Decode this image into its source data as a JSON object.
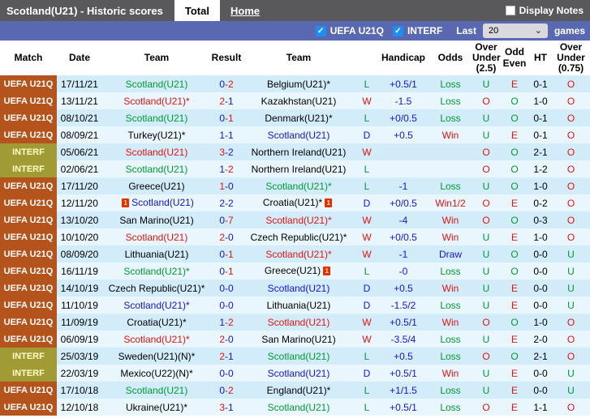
{
  "titlebar": {
    "title": "Scotland(U21) - Historic scores",
    "tabs": [
      {
        "label": "Total",
        "active": true
      },
      {
        "label": "Home",
        "active": false
      }
    ],
    "display_notes": {
      "label": "Display Notes",
      "checked": false
    }
  },
  "filterbar": {
    "filters": [
      {
        "label": "UEFA U21Q",
        "checked": true
      },
      {
        "label": "INTERF",
        "checked": true
      }
    ],
    "last_label": "Last",
    "selected_count": "20",
    "games_label": "games"
  },
  "table": {
    "headers": [
      "Match",
      "Date",
      "Team",
      "Result",
      "Team",
      "",
      "Handicap",
      "Odds",
      "Over\nUnder\n(2.5)",
      "Odd\nEven",
      "HT",
      "Over\nUnder\n(0.75)"
    ],
    "red_card_text": "1",
    "palette": {
      "red": "#e11414",
      "green": "#009933",
      "blue": "#1616cc",
      "black": "#000000"
    },
    "rows": [
      {
        "match": "UEFA U21Q",
        "match_type": "uefa",
        "date": "17/11/21",
        "home": {
          "name": "Scotland(U21)",
          "color": "green",
          "red_card": false
        },
        "score": {
          "home": "0",
          "away": "2",
          "home_color": "blue",
          "away_color": "red"
        },
        "away": {
          "name": "Belgium(U21)*",
          "color": "black",
          "red_card": false
        },
        "wdl": {
          "text": "L",
          "color": "green"
        },
        "handicap": "+0.5/1",
        "odds": {
          "text": "Loss",
          "color": "green"
        },
        "ou25": {
          "text": "U",
          "color": "green"
        },
        "odd_even": {
          "text": "E",
          "color": "red"
        },
        "ht": "0-1",
        "ou075": {
          "text": "O",
          "color": "red"
        }
      },
      {
        "match": "UEFA U21Q",
        "match_type": "uefa",
        "date": "13/11/21",
        "home": {
          "name": "Scotland(U21)*",
          "color": "red",
          "red_card": false
        },
        "score": {
          "home": "2",
          "away": "1",
          "home_color": "red",
          "away_color": "blue"
        },
        "away": {
          "name": "Kazakhstan(U21)",
          "color": "black",
          "red_card": false
        },
        "wdl": {
          "text": "W",
          "color": "red"
        },
        "handicap": "-1.5",
        "odds": {
          "text": "Loss",
          "color": "green"
        },
        "ou25": {
          "text": "O",
          "color": "red"
        },
        "odd_even": {
          "text": "O",
          "color": "green"
        },
        "ht": "1-0",
        "ou075": {
          "text": "O",
          "color": "red"
        }
      },
      {
        "match": "UEFA U21Q",
        "match_type": "uefa",
        "date": "08/10/21",
        "home": {
          "name": "Scotland(U21)",
          "color": "green",
          "red_card": false
        },
        "score": {
          "home": "0",
          "away": "1",
          "home_color": "blue",
          "away_color": "red"
        },
        "away": {
          "name": "Denmark(U21)*",
          "color": "black",
          "red_card": false
        },
        "wdl": {
          "text": "L",
          "color": "green"
        },
        "handicap": "+0/0.5",
        "odds": {
          "text": "Loss",
          "color": "green"
        },
        "ou25": {
          "text": "U",
          "color": "green"
        },
        "odd_even": {
          "text": "O",
          "color": "green"
        },
        "ht": "0-1",
        "ou075": {
          "text": "O",
          "color": "red"
        }
      },
      {
        "match": "UEFA U21Q",
        "match_type": "uefa",
        "date": "08/09/21",
        "home": {
          "name": "Turkey(U21)*",
          "color": "black",
          "red_card": false
        },
        "score": {
          "home": "1",
          "away": "1",
          "home_color": "blue",
          "away_color": "blue"
        },
        "away": {
          "name": "Scotland(U21)",
          "color": "blue",
          "red_card": false
        },
        "wdl": {
          "text": "D",
          "color": "blue"
        },
        "handicap": "+0.5",
        "odds": {
          "text": "Win",
          "color": "red"
        },
        "ou25": {
          "text": "U",
          "color": "green"
        },
        "odd_even": {
          "text": "E",
          "color": "red"
        },
        "ht": "0-1",
        "ou075": {
          "text": "O",
          "color": "red"
        }
      },
      {
        "match": "INTERF",
        "match_type": "interf",
        "date": "05/06/21",
        "home": {
          "name": "Scotland(U21)",
          "color": "red",
          "red_card": false
        },
        "score": {
          "home": "3",
          "away": "2",
          "home_color": "red",
          "away_color": "blue"
        },
        "away": {
          "name": "Northern Ireland(U21)",
          "color": "black",
          "red_card": false
        },
        "wdl": {
          "text": "W",
          "color": "red"
        },
        "handicap": "",
        "odds": {
          "text": "",
          "color": "black"
        },
        "ou25": {
          "text": "O",
          "color": "red"
        },
        "odd_even": {
          "text": "O",
          "color": "green"
        },
        "ht": "2-1",
        "ou075": {
          "text": "O",
          "color": "red"
        }
      },
      {
        "match": "INTERF",
        "match_type": "interf",
        "date": "02/06/21",
        "home": {
          "name": "Scotland(U21)",
          "color": "green",
          "red_card": false
        },
        "score": {
          "home": "1",
          "away": "2",
          "home_color": "blue",
          "away_color": "red"
        },
        "away": {
          "name": "Northern Ireland(U21)",
          "color": "black",
          "red_card": false
        },
        "wdl": {
          "text": "L",
          "color": "green"
        },
        "handicap": "",
        "odds": {
          "text": "",
          "color": "black"
        },
        "ou25": {
          "text": "O",
          "color": "red"
        },
        "odd_even": {
          "text": "O",
          "color": "green"
        },
        "ht": "1-2",
        "ou075": {
          "text": "O",
          "color": "red"
        }
      },
      {
        "match": "UEFA U21Q",
        "match_type": "uefa",
        "date": "17/11/20",
        "home": {
          "name": "Greece(U21)",
          "color": "black",
          "red_card": false
        },
        "score": {
          "home": "1",
          "away": "0",
          "home_color": "red",
          "away_color": "blue"
        },
        "away": {
          "name": "Scotland(U21)*",
          "color": "green",
          "red_card": false
        },
        "wdl": {
          "text": "L",
          "color": "green"
        },
        "handicap": "-1",
        "odds": {
          "text": "Loss",
          "color": "green"
        },
        "ou25": {
          "text": "U",
          "color": "green"
        },
        "odd_even": {
          "text": "O",
          "color": "green"
        },
        "ht": "1-0",
        "ou075": {
          "text": "O",
          "color": "red"
        }
      },
      {
        "match": "UEFA U21Q",
        "match_type": "uefa",
        "date": "12/11/20",
        "home": {
          "name": "Scotland(U21)",
          "color": "blue",
          "red_card": true
        },
        "score": {
          "home": "2",
          "away": "2",
          "home_color": "blue",
          "away_color": "blue"
        },
        "away": {
          "name": "Croatia(U21)*",
          "color": "black",
          "red_card": true
        },
        "wdl": {
          "text": "D",
          "color": "blue"
        },
        "handicap": "+0/0.5",
        "odds": {
          "text": "Win1/2",
          "color": "red"
        },
        "ou25": {
          "text": "O",
          "color": "red"
        },
        "odd_even": {
          "text": "E",
          "color": "red"
        },
        "ht": "0-2",
        "ou075": {
          "text": "O",
          "color": "red"
        }
      },
      {
        "match": "UEFA U21Q",
        "match_type": "uefa",
        "date": "13/10/20",
        "home": {
          "name": "San Marino(U21)",
          "color": "black",
          "red_card": false
        },
        "score": {
          "home": "0",
          "away": "7",
          "home_color": "blue",
          "away_color": "red"
        },
        "away": {
          "name": "Scotland(U21)*",
          "color": "red",
          "red_card": false
        },
        "wdl": {
          "text": "W",
          "color": "red"
        },
        "handicap": "-4",
        "odds": {
          "text": "Win",
          "color": "red"
        },
        "ou25": {
          "text": "O",
          "color": "red"
        },
        "odd_even": {
          "text": "O",
          "color": "green"
        },
        "ht": "0-3",
        "ou075": {
          "text": "O",
          "color": "red"
        }
      },
      {
        "match": "UEFA U21Q",
        "match_type": "uefa",
        "date": "10/10/20",
        "home": {
          "name": "Scotland(U21)",
          "color": "red",
          "red_card": false
        },
        "score": {
          "home": "2",
          "away": "0",
          "home_color": "red",
          "away_color": "blue"
        },
        "away": {
          "name": "Czech Republic(U21)*",
          "color": "black",
          "red_card": false
        },
        "wdl": {
          "text": "W",
          "color": "red"
        },
        "handicap": "+0/0.5",
        "odds": {
          "text": "Win",
          "color": "red"
        },
        "ou25": {
          "text": "U",
          "color": "green"
        },
        "odd_even": {
          "text": "E",
          "color": "red"
        },
        "ht": "1-0",
        "ou075": {
          "text": "O",
          "color": "red"
        }
      },
      {
        "match": "UEFA U21Q",
        "match_type": "uefa",
        "date": "08/09/20",
        "home": {
          "name": "Lithuania(U21)",
          "color": "black",
          "red_card": false
        },
        "score": {
          "home": "0",
          "away": "1",
          "home_color": "blue",
          "away_color": "red"
        },
        "away": {
          "name": "Scotland(U21)*",
          "color": "red",
          "red_card": false
        },
        "wdl": {
          "text": "W",
          "color": "red"
        },
        "handicap": "-1",
        "odds": {
          "text": "Draw",
          "color": "blue"
        },
        "ou25": {
          "text": "U",
          "color": "green"
        },
        "odd_even": {
          "text": "O",
          "color": "green"
        },
        "ht": "0-0",
        "ou075": {
          "text": "U",
          "color": "green"
        }
      },
      {
        "match": "UEFA U21Q",
        "match_type": "uefa",
        "date": "16/11/19",
        "home": {
          "name": "Scotland(U21)*",
          "color": "green",
          "red_card": false
        },
        "score": {
          "home": "0",
          "away": "1",
          "home_color": "blue",
          "away_color": "red"
        },
        "away": {
          "name": "Greece(U21)",
          "color": "black",
          "red_card": true
        },
        "wdl": {
          "text": "L",
          "color": "green"
        },
        "handicap": "-0",
        "odds": {
          "text": "Loss",
          "color": "green"
        },
        "ou25": {
          "text": "U",
          "color": "green"
        },
        "odd_even": {
          "text": "O",
          "color": "green"
        },
        "ht": "0-0",
        "ou075": {
          "text": "U",
          "color": "green"
        }
      },
      {
        "match": "UEFA U21Q",
        "match_type": "uefa",
        "date": "14/10/19",
        "home": {
          "name": "Czech Republic(U21)*",
          "color": "black",
          "red_card": false
        },
        "score": {
          "home": "0",
          "away": "0",
          "home_color": "blue",
          "away_color": "blue"
        },
        "away": {
          "name": "Scotland(U21)",
          "color": "blue",
          "red_card": false
        },
        "wdl": {
          "text": "D",
          "color": "blue"
        },
        "handicap": "+0.5",
        "odds": {
          "text": "Win",
          "color": "red"
        },
        "ou25": {
          "text": "U",
          "color": "green"
        },
        "odd_even": {
          "text": "E",
          "color": "red"
        },
        "ht": "0-0",
        "ou075": {
          "text": "U",
          "color": "green"
        }
      },
      {
        "match": "UEFA U21Q",
        "match_type": "uefa",
        "date": "11/10/19",
        "home": {
          "name": "Scotland(U21)*",
          "color": "blue",
          "red_card": false
        },
        "score": {
          "home": "0",
          "away": "0",
          "home_color": "blue",
          "away_color": "blue"
        },
        "away": {
          "name": "Lithuania(U21)",
          "color": "black",
          "red_card": false
        },
        "wdl": {
          "text": "D",
          "color": "blue"
        },
        "handicap": "-1.5/2",
        "odds": {
          "text": "Loss",
          "color": "green"
        },
        "ou25": {
          "text": "U",
          "color": "green"
        },
        "odd_even": {
          "text": "E",
          "color": "red"
        },
        "ht": "0-0",
        "ou075": {
          "text": "U",
          "color": "green"
        }
      },
      {
        "match": "UEFA U21Q",
        "match_type": "uefa",
        "date": "11/09/19",
        "home": {
          "name": "Croatia(U21)*",
          "color": "black",
          "red_card": false
        },
        "score": {
          "home": "1",
          "away": "2",
          "home_color": "blue",
          "away_color": "red"
        },
        "away": {
          "name": "Scotland(U21)",
          "color": "red",
          "red_card": false
        },
        "wdl": {
          "text": "W",
          "color": "red"
        },
        "handicap": "+0.5/1",
        "odds": {
          "text": "Win",
          "color": "red"
        },
        "ou25": {
          "text": "O",
          "color": "red"
        },
        "odd_even": {
          "text": "O",
          "color": "green"
        },
        "ht": "1-0",
        "ou075": {
          "text": "O",
          "color": "red"
        }
      },
      {
        "match": "UEFA U21Q",
        "match_type": "uefa",
        "date": "06/09/19",
        "home": {
          "name": "Scotland(U21)*",
          "color": "red",
          "red_card": false
        },
        "score": {
          "home": "2",
          "away": "0",
          "home_color": "red",
          "away_color": "blue"
        },
        "away": {
          "name": "San Marino(U21)",
          "color": "black",
          "red_card": false
        },
        "wdl": {
          "text": "W",
          "color": "red"
        },
        "handicap": "-3.5/4",
        "odds": {
          "text": "Loss",
          "color": "green"
        },
        "ou25": {
          "text": "U",
          "color": "green"
        },
        "odd_even": {
          "text": "E",
          "color": "red"
        },
        "ht": "2-0",
        "ou075": {
          "text": "O",
          "color": "red"
        }
      },
      {
        "match": "INTERF",
        "match_type": "interf",
        "date": "25/03/19",
        "home": {
          "name": "Sweden(U21)(N)*",
          "color": "black",
          "red_card": false
        },
        "score": {
          "home": "2",
          "away": "1",
          "home_color": "red",
          "away_color": "blue"
        },
        "away": {
          "name": "Scotland(U21)",
          "color": "green",
          "red_card": false
        },
        "wdl": {
          "text": "L",
          "color": "green"
        },
        "handicap": "+0.5",
        "odds": {
          "text": "Loss",
          "color": "green"
        },
        "ou25": {
          "text": "O",
          "color": "red"
        },
        "odd_even": {
          "text": "O",
          "color": "green"
        },
        "ht": "2-1",
        "ou075": {
          "text": "O",
          "color": "red"
        }
      },
      {
        "match": "INTERF",
        "match_type": "interf",
        "date": "22/03/19",
        "home": {
          "name": "Mexico(U22)(N)*",
          "color": "black",
          "red_card": false
        },
        "score": {
          "home": "0",
          "away": "0",
          "home_color": "blue",
          "away_color": "blue"
        },
        "away": {
          "name": "Scotland(U21)",
          "color": "blue",
          "red_card": false
        },
        "wdl": {
          "text": "D",
          "color": "blue"
        },
        "handicap": "+0.5/1",
        "odds": {
          "text": "Win",
          "color": "red"
        },
        "ou25": {
          "text": "U",
          "color": "green"
        },
        "odd_even": {
          "text": "E",
          "color": "red"
        },
        "ht": "0-0",
        "ou075": {
          "text": "U",
          "color": "green"
        }
      },
      {
        "match": "UEFA U21Q",
        "match_type": "uefa",
        "date": "17/10/18",
        "home": {
          "name": "Scotland(U21)",
          "color": "green",
          "red_card": false
        },
        "score": {
          "home": "0",
          "away": "2",
          "home_color": "blue",
          "away_color": "red"
        },
        "away": {
          "name": "England(U21)*",
          "color": "black",
          "red_card": false
        },
        "wdl": {
          "text": "L",
          "color": "green"
        },
        "handicap": "+1/1.5",
        "odds": {
          "text": "Loss",
          "color": "green"
        },
        "ou25": {
          "text": "U",
          "color": "green"
        },
        "odd_even": {
          "text": "E",
          "color": "red"
        },
        "ht": "0-0",
        "ou075": {
          "text": "U",
          "color": "green"
        }
      },
      {
        "match": "UEFA U21Q",
        "match_type": "uefa",
        "date": "12/10/18",
        "home": {
          "name": "Ukraine(U21)*",
          "color": "black",
          "red_card": false
        },
        "score": {
          "home": "3",
          "away": "1",
          "home_color": "red",
          "away_color": "blue"
        },
        "away": {
          "name": "Scotland(U21)",
          "color": "green",
          "red_card": false
        },
        "wdl": {
          "text": "L",
          "color": "green"
        },
        "handicap": "+0.5/1",
        "odds": {
          "text": "Loss",
          "color": "green"
        },
        "ou25": {
          "text": "O",
          "color": "red"
        },
        "odd_even": {
          "text": "E",
          "color": "red"
        },
        "ht": "1-1",
        "ou075": {
          "text": "O",
          "color": "red"
        }
      }
    ]
  }
}
